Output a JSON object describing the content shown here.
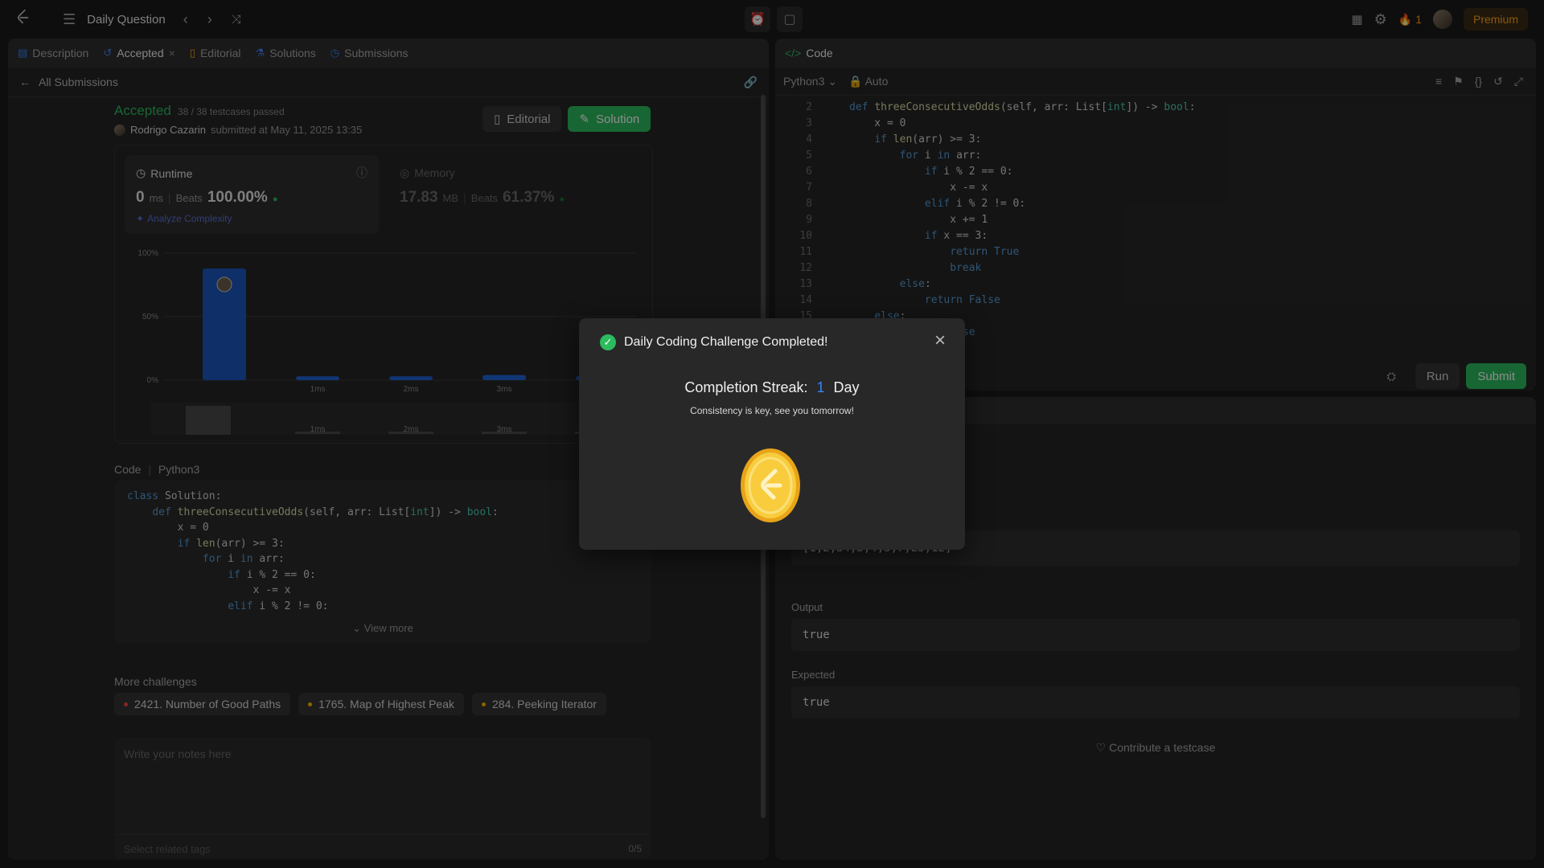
{
  "topbar": {
    "title": "Daily Question",
    "streak_count": "1",
    "premium_label": "Premium"
  },
  "left": {
    "tabs": [
      {
        "label": "Description"
      },
      {
        "label": "Accepted"
      },
      {
        "label": "Editorial"
      },
      {
        "label": "Solutions"
      },
      {
        "label": "Submissions"
      }
    ],
    "back_label": "All Submissions",
    "status": "Accepted",
    "testcases": "38 / 38 testcases passed",
    "user_name": "Rodrigo Cazarin",
    "submitted_text": "submitted at May 11, 2025 13:35",
    "editorial_btn": "Editorial",
    "solution_btn": "Solution",
    "runtime": {
      "label": "Runtime",
      "value": "0",
      "unit": "ms",
      "beats_label": "Beats",
      "beats_value": "100.00%",
      "analyze": "Analyze Complexity"
    },
    "memory": {
      "label": "Memory",
      "value": "17.83",
      "unit": "MB",
      "beats_label": "Beats",
      "beats_value": "61.37%"
    },
    "code_label": "Code",
    "code_lang": "Python3",
    "code_lines": [
      "class Solution:",
      "    def threeConsecutiveOdds(self, arr: List[int]) -> bool:",
      "        x = 0",
      "        if len(arr) >= 3:",
      "            for i in arr:",
      "                if i % 2 == 0:",
      "                    x -= x",
      "                elif i % 2 != 0:"
    ],
    "view_more": "View more",
    "more_challenges_label": "More challenges",
    "challenges": [
      {
        "label": "2421. Number of Good Paths",
        "color": "#ef4743"
      },
      {
        "label": "1765. Map of Highest Peak",
        "color": "#ffb800"
      },
      {
        "label": "284. Peeking Iterator",
        "color": "#ffb800"
      }
    ],
    "notes_placeholder": "Write your notes here",
    "tags_placeholder": "Select related tags",
    "tags_count": "0/5"
  },
  "chart_data": {
    "type": "bar",
    "categories": [
      "0ms",
      "1ms",
      "2ms",
      "3ms",
      "4ms"
    ],
    "values": [
      88,
      3,
      3,
      4,
      3
    ],
    "x_tick_labels": [
      "1ms",
      "2ms",
      "3ms",
      "4"
    ],
    "brush_tick_labels": [
      "1ms",
      "2ms",
      "3ms",
      "4"
    ],
    "y_tick_labels": [
      "100%",
      "50%",
      "0%"
    ],
    "ylim": [
      0,
      100
    ],
    "bar_color": "#1f63d6",
    "highlight_color": "#1a56bd"
  },
  "code_panel": {
    "title": "Code",
    "lang": "Python3",
    "auto": "Auto",
    "start_line": 2,
    "lines": [
      "    def threeConsecutiveOdds(self, arr: List[int]) -> bool:",
      "        x = 0",
      "        if len(arr) >= 3:",
      "            for i in arr:",
      "                if i % 2 == 0:",
      "                    x -= x",
      "                elif i % 2 != 0:",
      "                    x += 1",
      "                if x == 3:",
      "                    return True",
      "                    break",
      "            else:",
      "                return False",
      "        else:",
      "            return False"
    ],
    "run_label": "Run",
    "submit_label": "Submit"
  },
  "result": {
    "input_value": "[1,2,34,3,4,5,7,23,12]",
    "output_label": "Output",
    "output_value": "true",
    "expected_label": "Expected",
    "expected_value": "true",
    "contribute": "Contribute a testcase"
  },
  "modal": {
    "title": "Daily Coding Challenge Completed!",
    "streak_label": "Completion Streak:",
    "streak_value": "1",
    "streak_unit": "Day",
    "message": "Consistency is key, see you tomorrow!"
  }
}
